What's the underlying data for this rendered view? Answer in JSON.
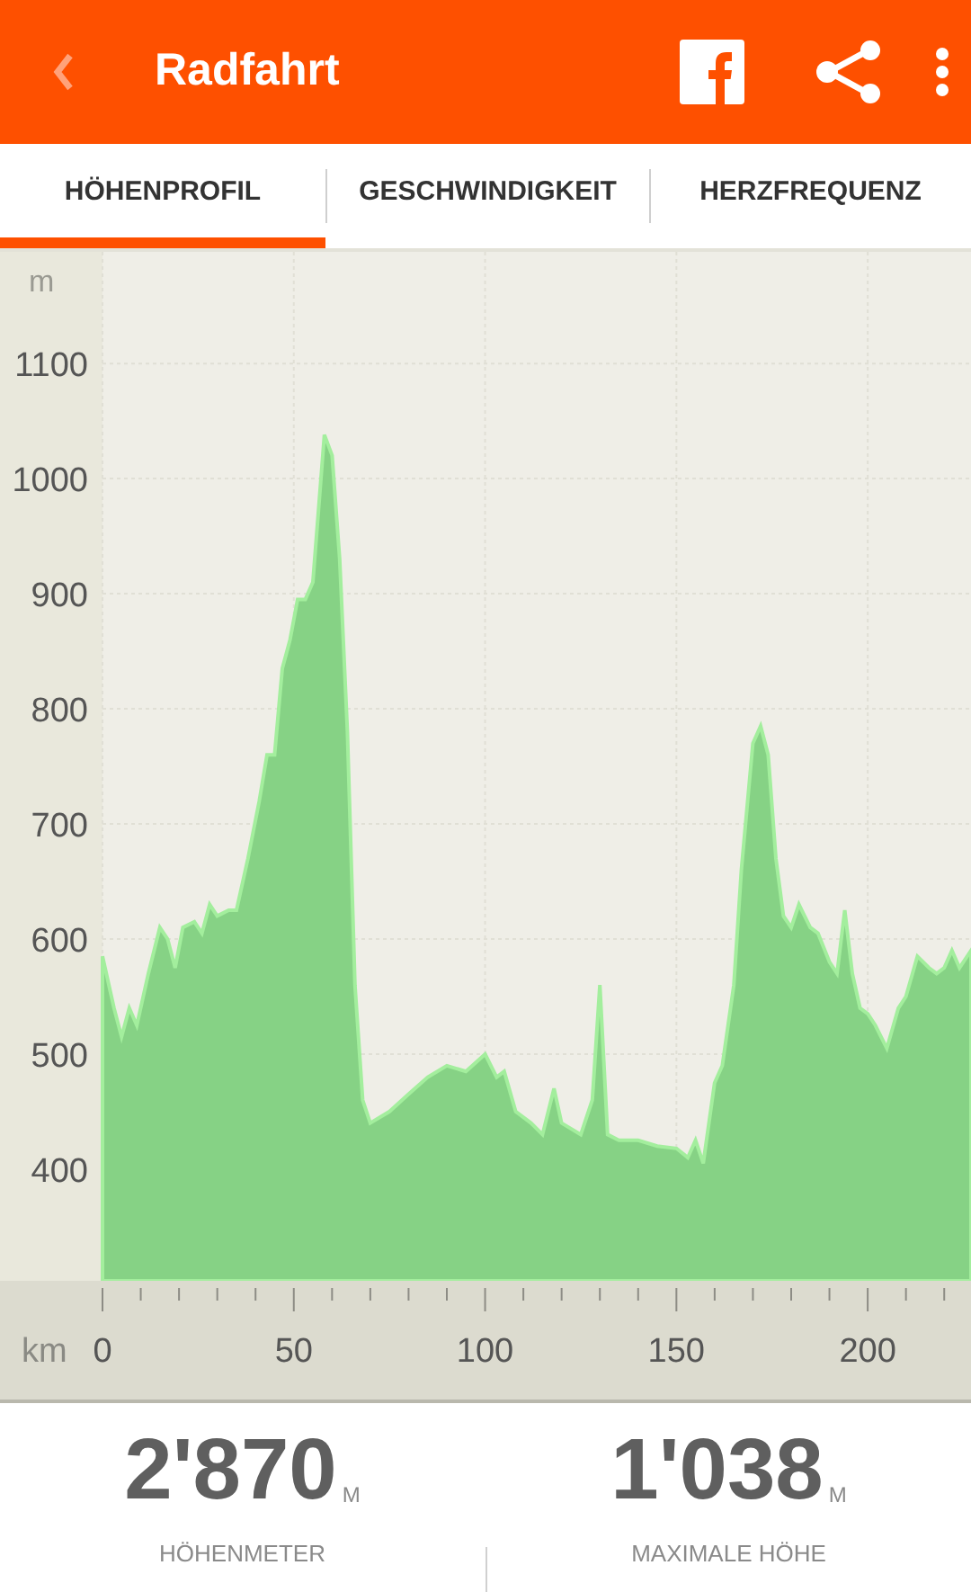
{
  "app_bar": {
    "title": "Radfahrt"
  },
  "tabs": [
    {
      "label": "HÖHENPROFIL",
      "selected": true
    },
    {
      "label": "GESCHWINDIGKEIT",
      "selected": false
    },
    {
      "label": "HERZFREQUENZ",
      "selected": false
    }
  ],
  "chart_data": {
    "type": "area",
    "grid": true,
    "xlabel": "km",
    "ylabel": "m",
    "xlim": [
      0,
      227
    ],
    "ylim": [
      303,
      1197
    ],
    "xticks": [
      0,
      50,
      100,
      150,
      200
    ],
    "yticks": [
      400,
      500,
      600,
      700,
      800,
      900,
      1000,
      1100
    ],
    "x": [
      0,
      3,
      5,
      7,
      9,
      12,
      15,
      17,
      19,
      21,
      24,
      26,
      28,
      30,
      33,
      35,
      38,
      41,
      43,
      45,
      47,
      49,
      51,
      53,
      55,
      58,
      60,
      62,
      64,
      66,
      68,
      70,
      75,
      80,
      85,
      90,
      95,
      100,
      103,
      105,
      108,
      112,
      115,
      118,
      120,
      125,
      128,
      130,
      132,
      135,
      140,
      145,
      150,
      153,
      155,
      157,
      160,
      162,
      165,
      167,
      170,
      172,
      174,
      176,
      178,
      180,
      182,
      185,
      187,
      190,
      192,
      194,
      196,
      198,
      200,
      202,
      205,
      208,
      210,
      213,
      216,
      218,
      220,
      222,
      224,
      227
    ],
    "series": [
      {
        "color": "#86d285",
        "values": [
          585,
          540,
          515,
          540,
          525,
          570,
          610,
          600,
          575,
          610,
          615,
          605,
          630,
          620,
          625,
          625,
          670,
          720,
          760,
          760,
          835,
          860,
          895,
          895,
          910,
          1038,
          1020,
          930,
          780,
          560,
          460,
          440,
          450,
          465,
          480,
          490,
          485,
          500,
          480,
          485,
          450,
          440,
          430,
          470,
          440,
          430,
          460,
          560,
          430,
          425,
          425,
          420,
          418,
          410,
          425,
          405,
          475,
          490,
          560,
          660,
          770,
          785,
          760,
          670,
          620,
          610,
          630,
          610,
          605,
          580,
          570,
          625,
          570,
          540,
          535,
          525,
          505,
          540,
          550,
          585,
          575,
          570,
          575,
          590,
          575,
          590
        ]
      }
    ]
  },
  "stats": [
    {
      "value": "2'870",
      "unit": "M",
      "label": "HÖHENMETER"
    },
    {
      "value": "1'038",
      "unit": "M",
      "label": "MAXIMALE HÖHE"
    }
  ]
}
